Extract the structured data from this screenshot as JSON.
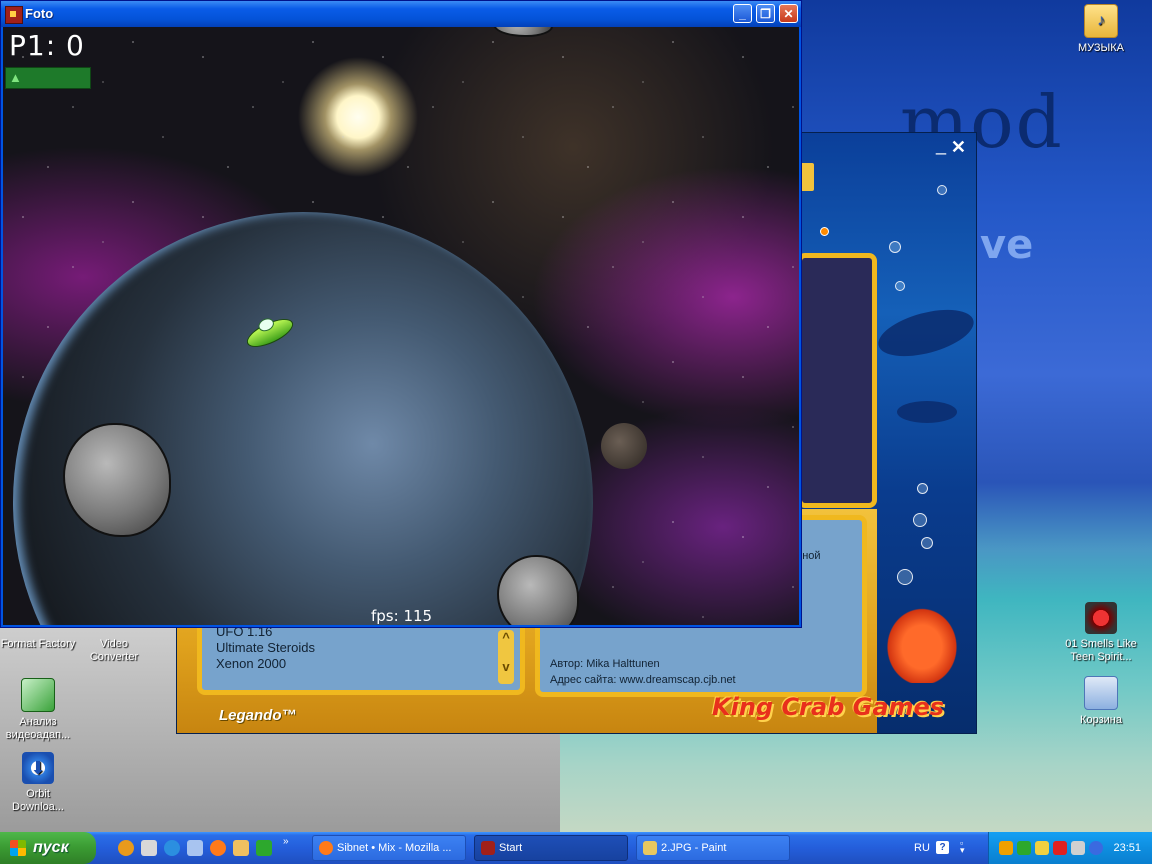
{
  "desktop": {
    "wallpaper_words": [
      "mod",
      "ve"
    ],
    "icons_right": [
      {
        "label": "МУЗЫКА"
      },
      {
        "label": "01 Smells Like Teen Spirit..."
      },
      {
        "label": "Корзина"
      }
    ],
    "icons_left": [
      {
        "label": "Format Factory"
      },
      {
        "label": "Video Converter"
      },
      {
        "label": "Анализ видеоадап..."
      },
      {
        "label": "Orbit Downloa..."
      }
    ]
  },
  "foto_window": {
    "title": "Foto",
    "buttons": {
      "minimize": "_",
      "maximize": "❐",
      "close": "✕"
    },
    "game": {
      "score_label": "P1:  0",
      "fps_label": "fps:  115"
    }
  },
  "kingcrab_window": {
    "list_items": [
      "UFO 1.16",
      "Ultimate Steroids",
      "Xenon 2000"
    ],
    "info_partial": "енной",
    "author_line": "Автор:  Mika Halttunen",
    "site_line": "Адрес сайта:  www.dreamscap.cjb.net",
    "legando": "Legando™",
    "logo": "King Crab Games",
    "scroll_up": "^",
    "scroll_down": "v"
  },
  "taskbar": {
    "start_label": "пуск",
    "tasks": [
      {
        "label": "Sibnet • Mix - Mozilla ...",
        "active": false
      },
      {
        "label": "Start",
        "active": true
      },
      {
        "label": "2.JPG - Paint",
        "active": false
      }
    ],
    "language": "RU",
    "help": "?",
    "clock": "23:51"
  },
  "colors": {
    "xp_blue": "#0054e3",
    "start_green": "#3a9a32",
    "tray_blue": "#0e8ee0",
    "kc_gold": "#f0b81e",
    "kc_red": "#e8301c"
  }
}
